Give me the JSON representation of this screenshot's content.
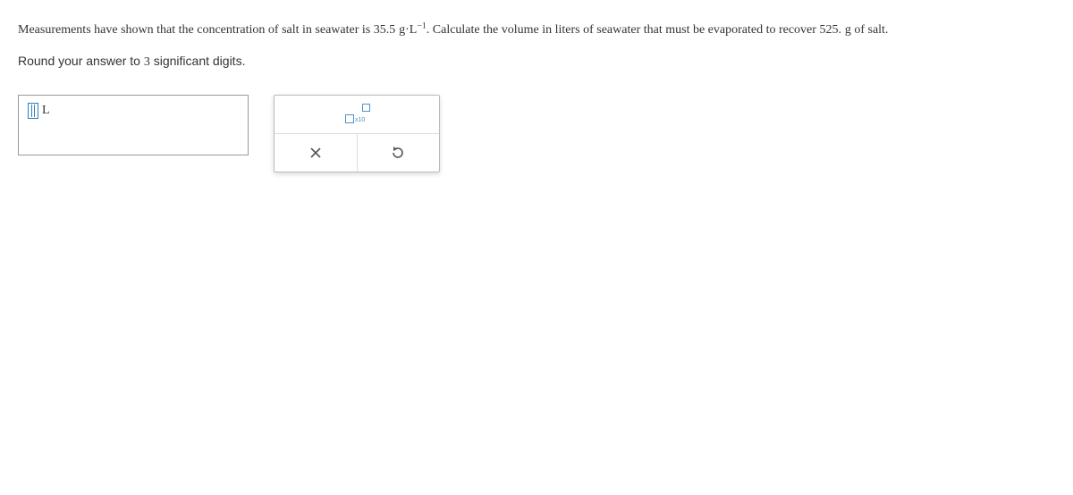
{
  "question": {
    "part1": "Measurements have shown that the concentration of salt in seawater is ",
    "value1": "35.5",
    "unit1_base": "g·L",
    "unit1_exp": "−1",
    "part2": ". Calculate the volume in liters of seawater that must be evaporated to recover ",
    "value2": "525.",
    "unit2": "g",
    "part3": " of salt."
  },
  "instruction": {
    "pre": "Round your answer to ",
    "sigfigs": "3",
    "post": " significant digits."
  },
  "answer": {
    "unit": "L"
  },
  "tools": {
    "sci_label": "x10"
  }
}
